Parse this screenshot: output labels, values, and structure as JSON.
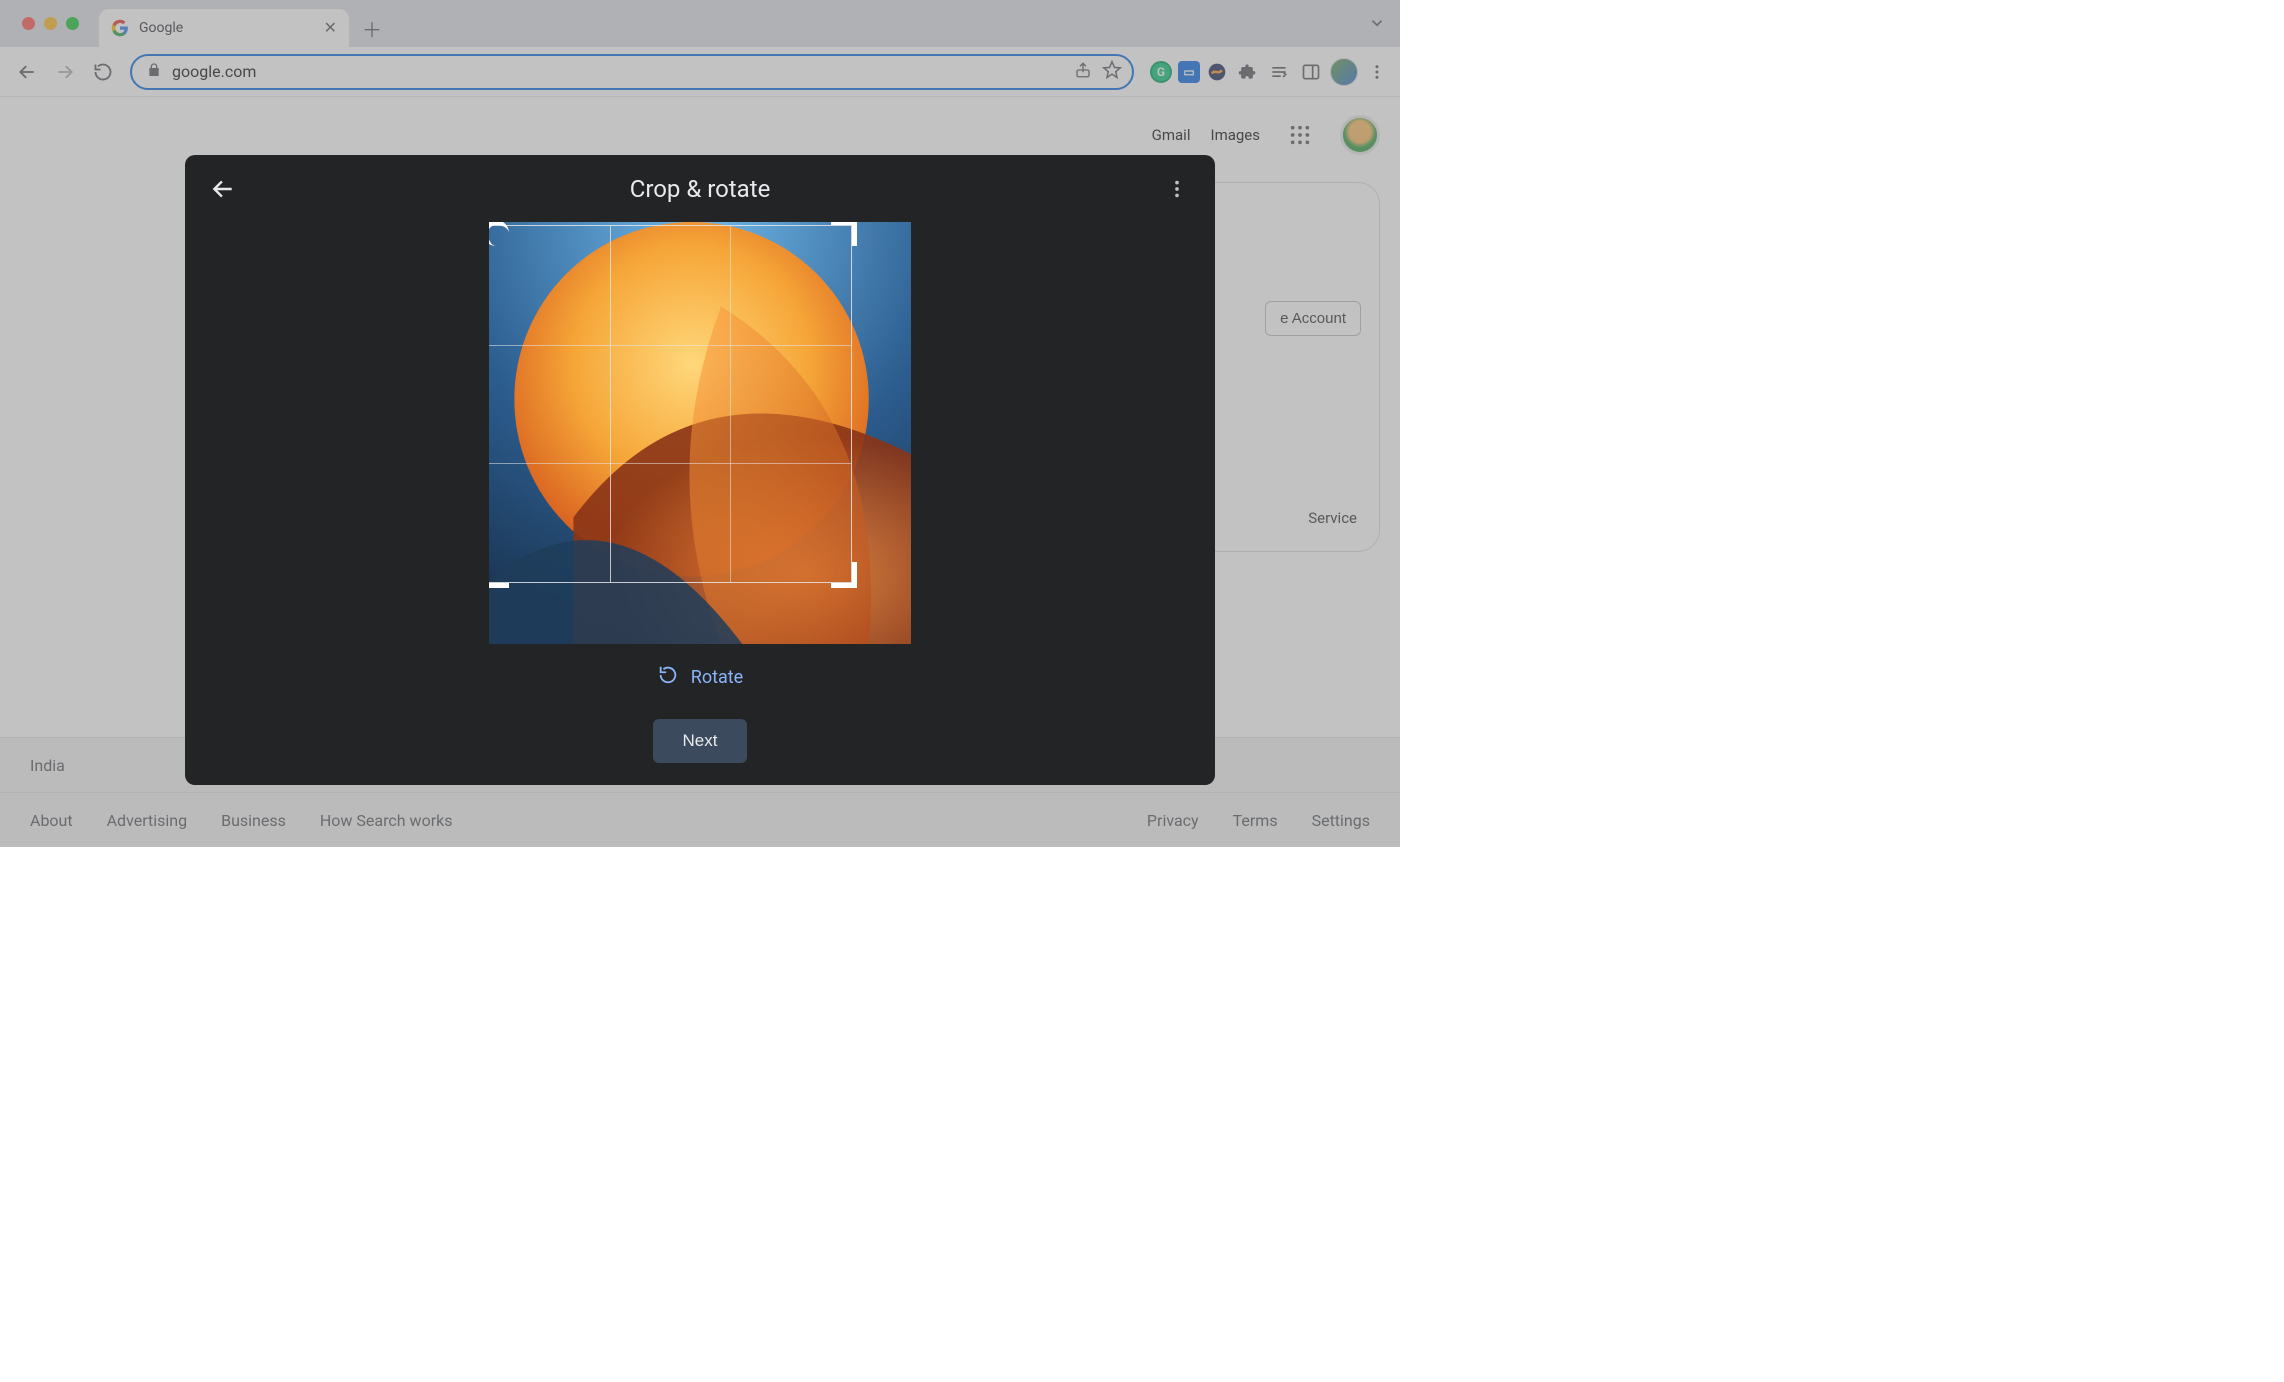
{
  "browser": {
    "tab_title": "Google",
    "url": "google.com"
  },
  "google_home": {
    "header_links": {
      "gmail": "Gmail",
      "images": "Images"
    },
    "account_button": "e Account",
    "service_text": "Service",
    "footer_region": "India",
    "footer_left": [
      "About",
      "Advertising",
      "Business",
      "How Search works"
    ],
    "footer_right": [
      "Privacy",
      "Terms",
      "Settings"
    ]
  },
  "modal": {
    "title": "Crop & rotate",
    "rotate_label": "Rotate",
    "next_label": "Next"
  }
}
